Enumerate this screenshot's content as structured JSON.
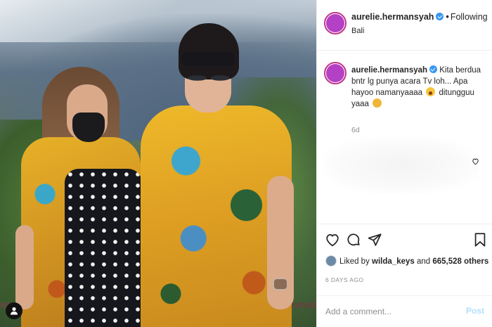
{
  "post": {
    "username": "aurelie.hermansyah",
    "follow_status": "Following",
    "location": "Bali",
    "caption": {
      "username": "aurelie.hermansyah",
      "text_part1": "Kita berdua bntr lg punya acara Tv loh... Apa hayoo namanyaaaa",
      "text_part2": "ditungguu yaaa",
      "emoji_1": "astonished-face-emoji",
      "emoji_2": "smiling-face-emoji"
    },
    "caption_time": "6d",
    "likes": {
      "prefix": "Liked by",
      "user": "wilda_keys",
      "middle": "and",
      "count": "665,528 others"
    },
    "date": "6 DAYS AGO"
  },
  "comment_box": {
    "placeholder": "Add a comment...",
    "post_label": "Post"
  },
  "icons": {
    "like": "heart-icon",
    "comment": "comment-icon",
    "share": "paper-plane-icon",
    "save": "bookmark-icon",
    "tagged": "user-tag-icon"
  },
  "colors": {
    "verified": "#3897f0",
    "avatar_ring": "#c13584",
    "avatar_fill": "#b441c5",
    "post_button": "#b2dffc",
    "muted_text": "#8e8e8e"
  }
}
